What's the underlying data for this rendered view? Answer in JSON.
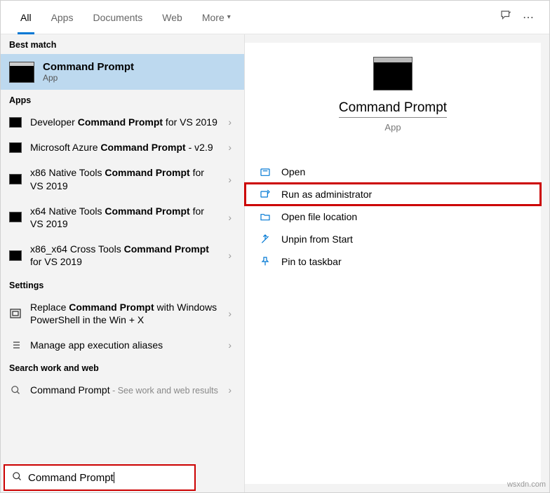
{
  "tabs": {
    "all": "All",
    "apps": "Apps",
    "documents": "Documents",
    "web": "Web",
    "more": "More"
  },
  "sections": {
    "best_match": "Best match",
    "apps": "Apps",
    "settings": "Settings",
    "search_work_web": "Search work and web"
  },
  "best_match": {
    "title": "Command Prompt",
    "subtitle": "App"
  },
  "apps_list": [
    {
      "pre": "Developer ",
      "bold": "Command Prompt",
      "post": " for VS 2019"
    },
    {
      "pre": "Microsoft Azure ",
      "bold": "Command Prompt",
      "post": " - v2.9"
    },
    {
      "pre": "x86 Native Tools ",
      "bold": "Command Prompt",
      "post": " for VS 2019"
    },
    {
      "pre": "x64 Native Tools ",
      "bold": "Command Prompt",
      "post": " for VS 2019"
    },
    {
      "pre": "x86_x64 Cross Tools ",
      "bold": "Command Prompt",
      "post": " for VS 2019"
    }
  ],
  "settings_list": [
    {
      "pre": "Replace ",
      "bold": "Command Prompt",
      "post": " with Windows PowerShell in the Win + X"
    },
    {
      "pre": "Manage app execution aliases",
      "bold": "",
      "post": ""
    }
  ],
  "web_list": [
    {
      "title": "Command Prompt",
      "hint": " - See work and web results"
    }
  ],
  "preview": {
    "title": "Command Prompt",
    "subtitle": "App"
  },
  "actions": {
    "open": "Open",
    "run_admin": "Run as administrator",
    "open_loc": "Open file location",
    "unpin": "Unpin from Start",
    "pin": "Pin to taskbar"
  },
  "search": {
    "value": "Command Prompt"
  },
  "watermark": "wsxdn.com"
}
